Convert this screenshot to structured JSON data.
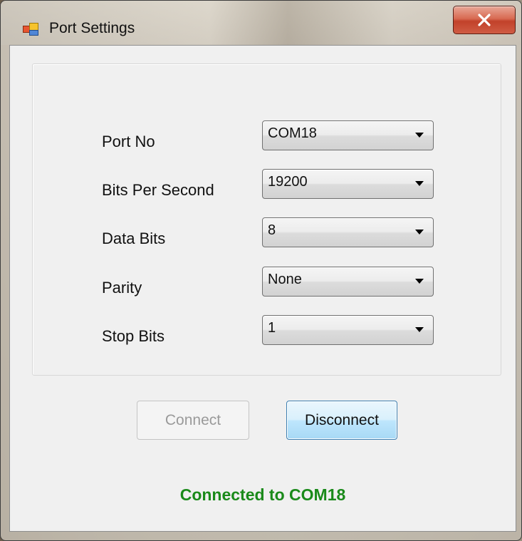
{
  "window": {
    "title": "Port Settings",
    "app_icon": "window-app-icon",
    "close_icon": "close-x-icon"
  },
  "fields": [
    {
      "label": "Port No",
      "value": "COM18"
    },
    {
      "label": "Bits Per Second",
      "value": "19200"
    },
    {
      "label": "Data Bits",
      "value": "8"
    },
    {
      "label": "Parity",
      "value": "None"
    },
    {
      "label": "Stop Bits",
      "value": "1"
    }
  ],
  "buttons": {
    "connect_label": "Connect",
    "connect_enabled": false,
    "disconnect_label": "Disconnect",
    "disconnect_focused": true
  },
  "status": {
    "text": "Connected to COM18",
    "color": "#1a8a1a"
  }
}
